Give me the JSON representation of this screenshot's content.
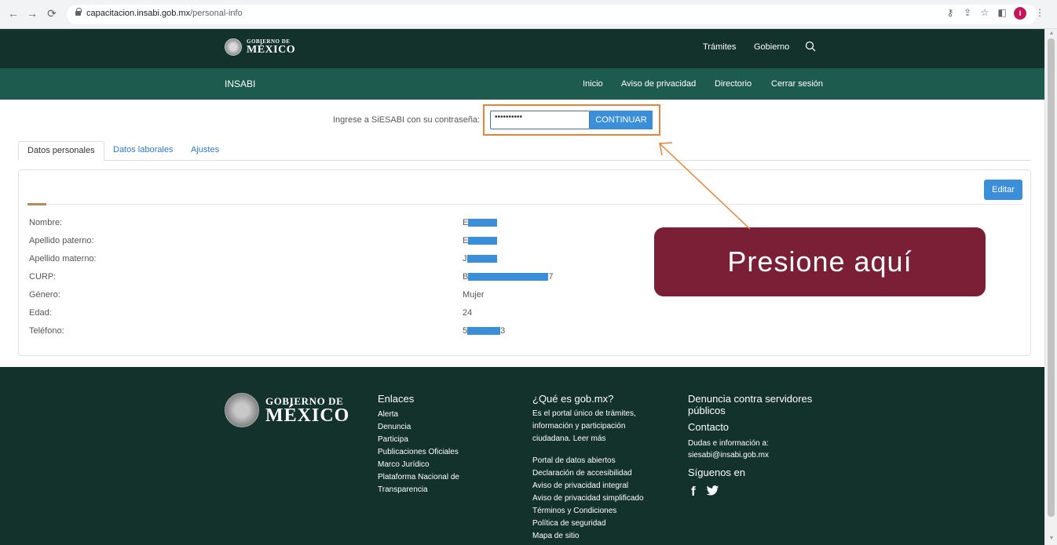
{
  "browser": {
    "url_host": "capacitacion.insabi.gob.mx",
    "url_path": "/personal-info",
    "profile_initial": "I"
  },
  "header": {
    "logo_line1": "GOBIERNO DE",
    "logo_line2": "MÉXICO",
    "nav": [
      "Trámites",
      "Gobierno"
    ]
  },
  "subheader": {
    "brand": "INSABI",
    "nav": [
      "Inicio",
      "Aviso de privacidad",
      "Directorio",
      "Cerrar sesión"
    ]
  },
  "login": {
    "prompt": "Ingrese a SiESABI con su contraseña:",
    "password_value": "••••••••••",
    "continue_label": "CONTINUAR"
  },
  "tabs": [
    "Datos personales",
    "Datos laborales",
    "Ajustes"
  ],
  "card": {
    "edit_label": "Editar",
    "rows": [
      {
        "label": "Nombre:",
        "prefix": "E",
        "suffix": ""
      },
      {
        "label": "Apellido paterno:",
        "prefix": "E",
        "suffix": ""
      },
      {
        "label": "Apellido materno:",
        "prefix": "J",
        "suffix": ""
      },
      {
        "label": "CURP:",
        "prefix": "B",
        "suffix": "7"
      },
      {
        "label": "Género:",
        "prefix": "Mujer",
        "suffix": ""
      },
      {
        "label": "Edad:",
        "prefix": "24",
        "suffix": ""
      },
      {
        "label": "Teléfono:",
        "prefix": "5",
        "suffix": "3"
      }
    ]
  },
  "callout": "Presione aquí",
  "footer": {
    "logo_line1": "GOBIERNO DE",
    "logo_line2": "MÉXICO",
    "enlaces_title": "Enlaces",
    "enlaces": [
      "Alerta",
      "Denuncia",
      "Participa",
      "Publicaciones Oficiales",
      "Marco Jurídico",
      "Plataforma Nacional de",
      "Transparencia"
    ],
    "que_es_title": "¿Qué es gob.mx?",
    "que_es_text": [
      "Es el portal único de trámites,",
      "información y participación",
      "ciudadana. Leer más"
    ],
    "que_es_links": [
      "Portal de datos abiertos",
      "Declaración de accesibilidad",
      "Aviso de privacidad integral",
      "Aviso de privacidad simplificado",
      "Términos y Condiciones",
      "Política de seguridad",
      "Mapa de sitio"
    ],
    "denuncia_title": [
      "Denuncia contra servidores",
      "públicos"
    ],
    "contacto_title": "Contacto",
    "contacto_text": [
      "Dudas e información a:",
      "siesabi@insabi.gob.mx"
    ],
    "siguenos_title": "Síguenos en",
    "social": [
      "f",
      "🐦"
    ]
  },
  "colors": {
    "header_dark": "#13322b",
    "header_green": "#1e5b4f",
    "accent_blue": "#3a8fd8",
    "callout_bg": "#7a1f36",
    "highlight": "#e8833a",
    "gold": "#b38e5d"
  }
}
